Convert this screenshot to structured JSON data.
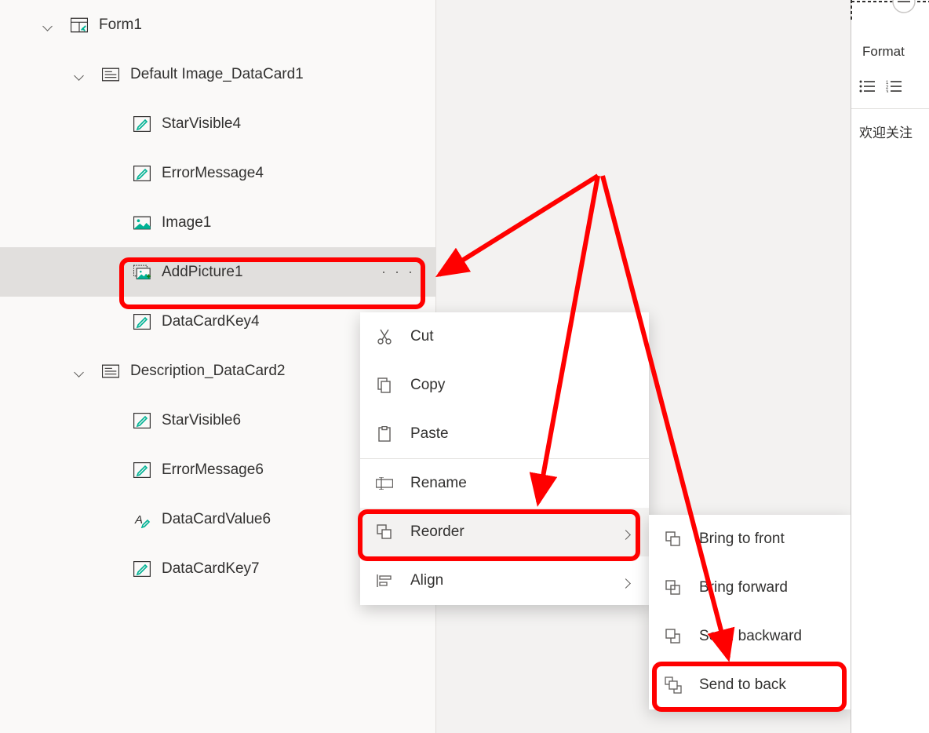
{
  "tree": {
    "form": "Form1",
    "card1": "Default Image_DataCard1",
    "card1_children": [
      "StarVisible4",
      "ErrorMessage4",
      "Image1",
      "AddPicture1",
      "DataCardKey4"
    ],
    "card2": "Description_DataCard2",
    "card2_children": [
      "StarVisible6",
      "ErrorMessage6",
      "DataCardValue6",
      "DataCardKey7"
    ]
  },
  "context_menu": {
    "cut": "Cut",
    "copy": "Copy",
    "paste": "Paste",
    "rename": "Rename",
    "reorder": "Reorder",
    "align": "Align"
  },
  "reorder_submenu": {
    "bring_front": "Bring to front",
    "bring_forward": "Bring forward",
    "send_backward": "Send backward",
    "send_back": "Send to back"
  },
  "right_panel": {
    "tab": "Format",
    "body": "欢迎关注"
  }
}
